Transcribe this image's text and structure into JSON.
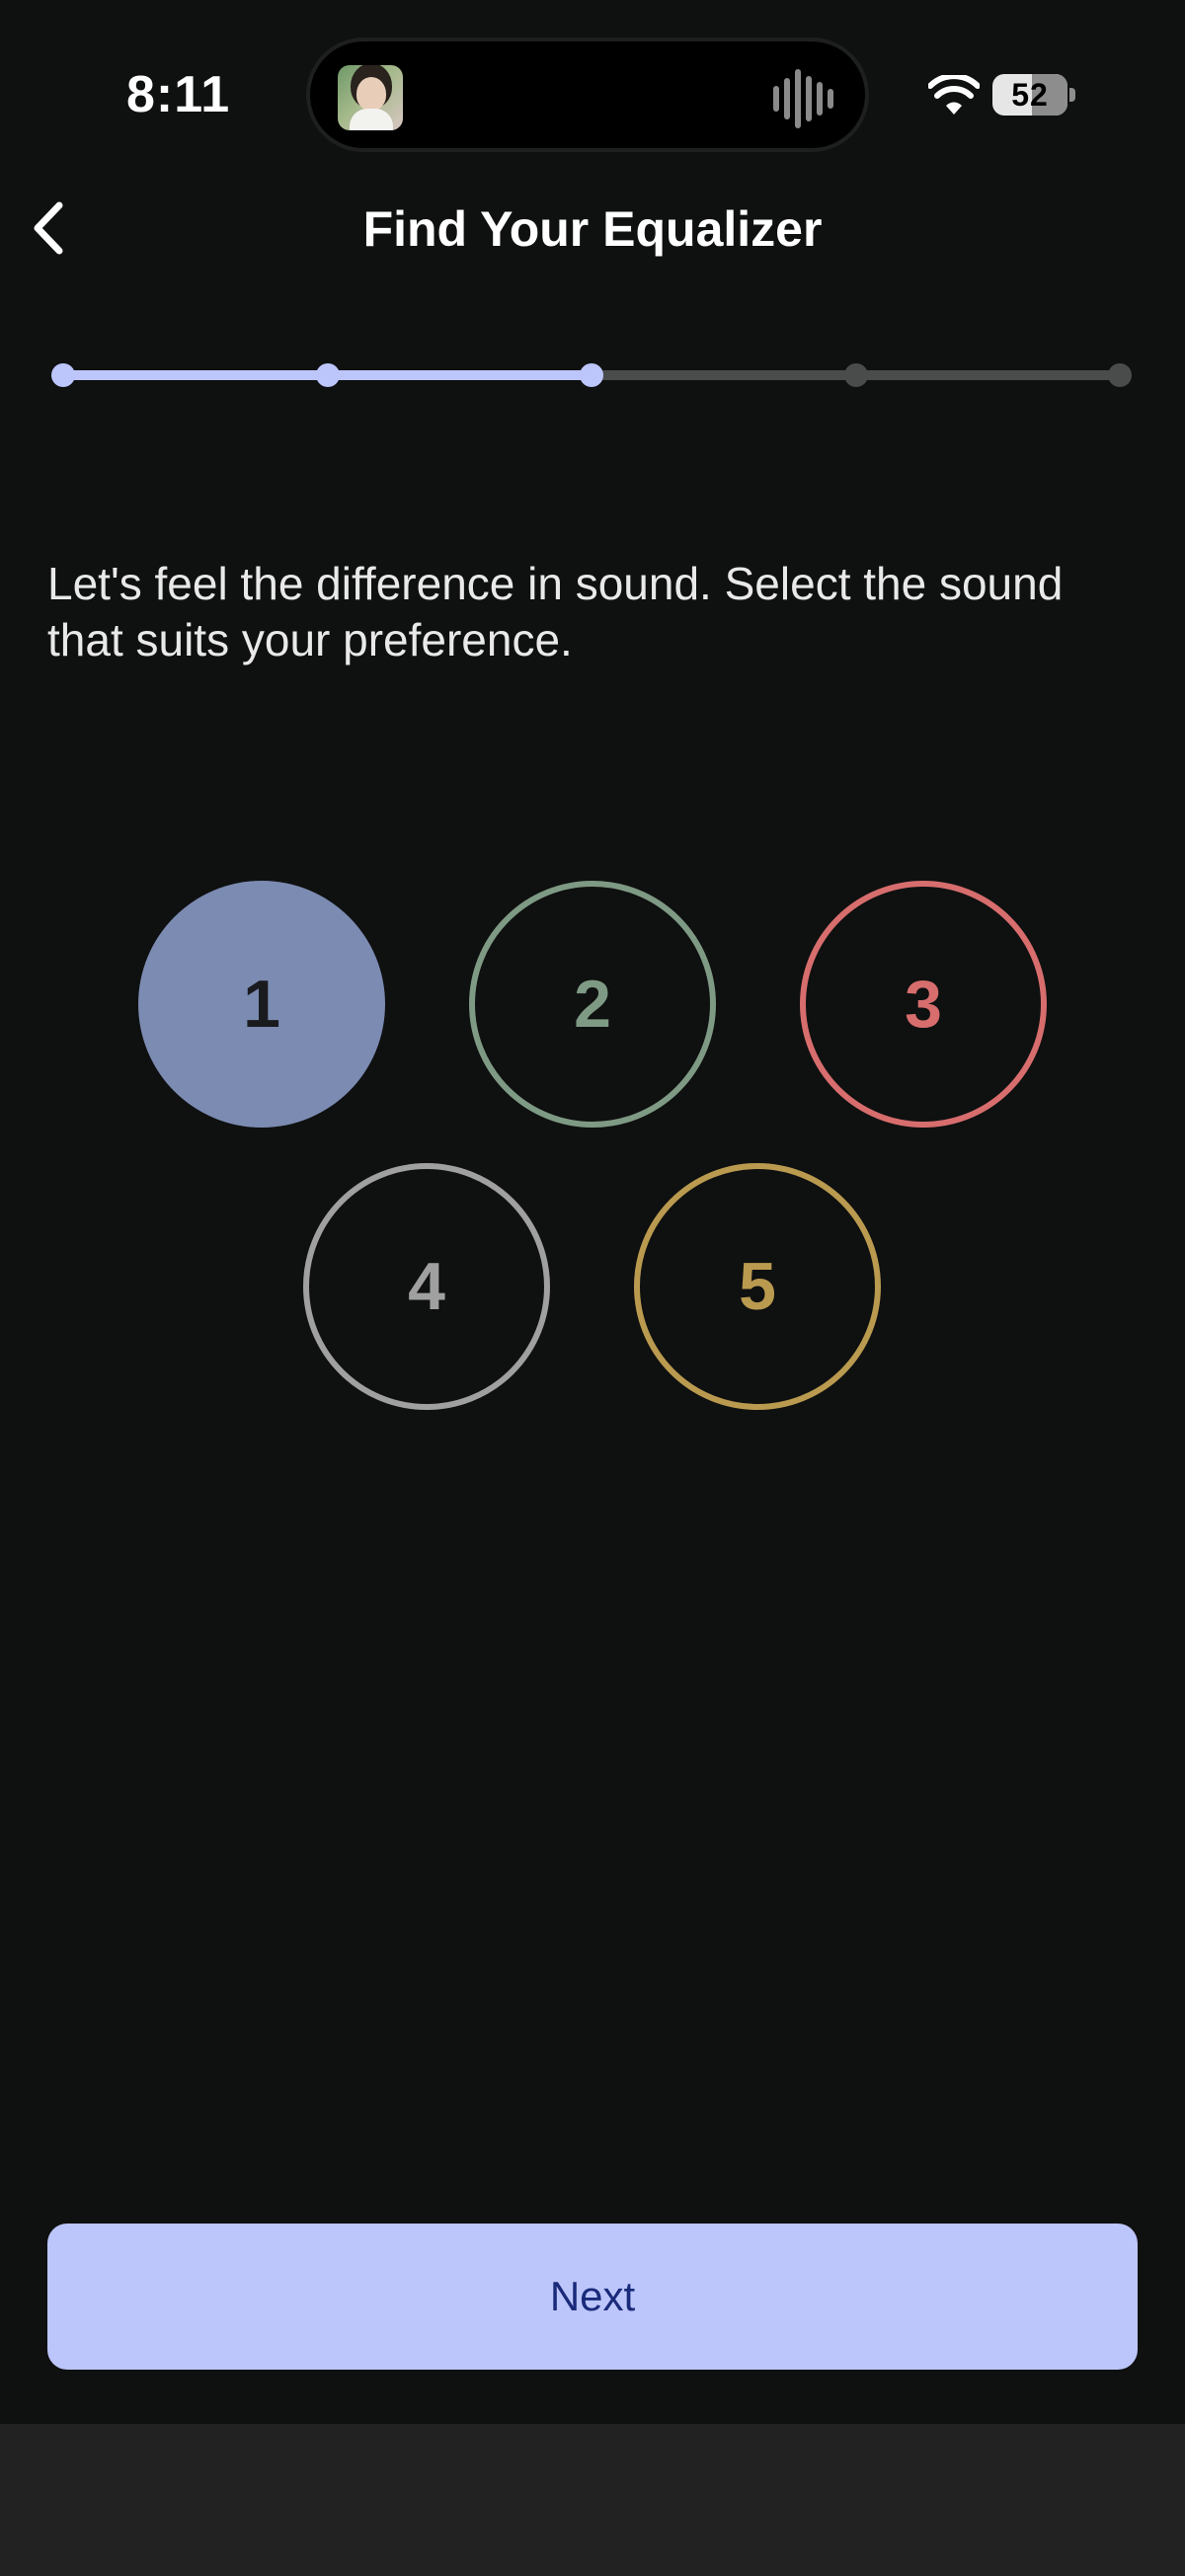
{
  "status_bar": {
    "time": "8:11",
    "battery": "52",
    "battery_level": 0.52,
    "icons": [
      "now-playing-thumbnail",
      "audio-waveform-icon",
      "wifi-icon",
      "battery-icon"
    ]
  },
  "header": {
    "title": "Find Your Equalizer",
    "back_icon": "chevron-left-icon"
  },
  "progress": {
    "steps_total": 5,
    "current_step": 3,
    "colors": {
      "active": "#bcc6fb",
      "inactive": "#4a4b4b"
    }
  },
  "instruction": "Let's feel the difference in sound. Select the sound that suits your preference.",
  "sound_options": [
    {
      "label": "1",
      "color": "#7b8bb2",
      "selected": true
    },
    {
      "label": "2",
      "color": "#7e9a84",
      "selected": false
    },
    {
      "label": "3",
      "color": "#d76d6d",
      "selected": false
    },
    {
      "label": "4",
      "color": "#a0a0a0",
      "selected": false
    },
    {
      "label": "5",
      "color": "#b99a4f",
      "selected": false
    }
  ],
  "next_button": {
    "label": "Next"
  },
  "colors": {
    "background": "#0f1010",
    "accent": "#bcc6fb",
    "button_text": "#1a2a7a"
  }
}
